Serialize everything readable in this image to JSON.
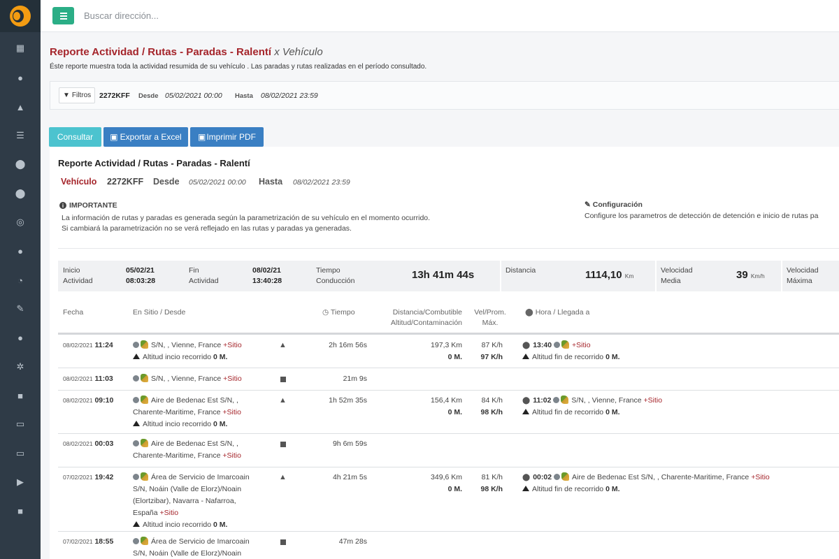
{
  "app": {
    "search_placeholder": "Buscar dirección..."
  },
  "sidebar": {
    "items": [
      {
        "icon": "dashboard-icon",
        "glyph": "▦"
      },
      {
        "icon": "globe-icon",
        "glyph": "●"
      },
      {
        "icon": "road-icon",
        "glyph": "▲"
      },
      {
        "icon": "list-icon",
        "glyph": "☰"
      },
      {
        "icon": "map-pin-icon",
        "glyph": "⬤"
      },
      {
        "icon": "map-marker-icon",
        "glyph": "⬤"
      },
      {
        "icon": "target-icon",
        "glyph": "◎"
      },
      {
        "icon": "alert-icon",
        "glyph": "●"
      },
      {
        "icon": "speedometer-icon",
        "glyph": "◔"
      },
      {
        "icon": "wrench-icon",
        "glyph": "✎"
      },
      {
        "icon": "fuel-drop-icon",
        "glyph": "●"
      },
      {
        "icon": "settings-cogs-icon",
        "glyph": "✲"
      },
      {
        "icon": "truck-icon",
        "glyph": "■"
      },
      {
        "icon": "id-card-icon",
        "glyph": "▭"
      },
      {
        "icon": "id-card-icon-2",
        "glyph": "▭"
      },
      {
        "icon": "play-icon",
        "glyph": "▶"
      },
      {
        "icon": "lock-icon",
        "glyph": "■"
      }
    ]
  },
  "page": {
    "title": "Reporte Actividad / Rutas - Paradas - Ralentí",
    "title_suffix": "x Vehículo",
    "description": "Éste reporte muestra toda la actividad resumida de su vehículo . Las paradas y rutas realizadas en el período consultado."
  },
  "filters": {
    "button_label": "Filtros",
    "plate": "2272KFF",
    "desde_label": "Desde",
    "desde_value": "05/02/2021 00:00",
    "hasta_label": "Hasta",
    "hasta_value": "08/02/2021 23:59"
  },
  "actions": {
    "consultar": "Consultar",
    "excel": "Exportar a Excel",
    "pdf": "Imprimir PDF"
  },
  "report": {
    "title": "Reporte Actividad / Rutas - Paradas - Ralentí",
    "vehicle_label": "Vehículo",
    "plate": "2272KFF",
    "desde_label": "Desde",
    "desde_value": "05/02/2021 00:00",
    "hasta_label": "Hasta",
    "hasta_value": "08/02/2021 23:59",
    "important_title": "IMPORTANTE",
    "important_line1": "La información de rutas y paradas es generada según la parametrización de su vehículo en el momento ocurrido.",
    "important_line2": "Si cambiará la parametrización no se verá reflejado en las rutas y paradas ya generadas.",
    "config_title": "Configuración",
    "config_text": "Configure los parametros de detección de detención e inicio de rutas pa"
  },
  "summary": {
    "inicio_label1": "Inicio",
    "inicio_label2": "Actividad",
    "inicio_date": "05/02/21",
    "inicio_time": "08:03:28",
    "fin_label1": "Fin",
    "fin_label2": "Actividad",
    "fin_date": "08/02/21",
    "fin_time": "13:40:28",
    "tiempo_label1": "Tiempo",
    "tiempo_label2": "Conducción",
    "tiempo_value": "13h 41m 44s",
    "distancia_label": "Distancia",
    "distancia_value": "1114,10",
    "distancia_unit": "Km",
    "velmedia_label1": "Velocidad",
    "velmedia_label2": "Media",
    "velmedia_value": "39",
    "velmedia_unit": "Km/h",
    "velmax_label1": "Velocidad",
    "velmax_label2": "Máxima"
  },
  "table": {
    "headers": {
      "fecha": "Fecha",
      "sitio": "En Sitio / Desde",
      "tiempo": "Tiempo",
      "dist1": "Distancia/Combutible",
      "dist2": "Altitud/Contaminación",
      "vel1": "Vel/Prom.",
      "vel2": "Máx.",
      "hora": "Hora / Llegada a"
    },
    "rows": [
      {
        "date": "08/02/2021",
        "time": "11:24",
        "type": "route",
        "place": "S/N, , Vienne, France",
        "sitio": "+Sitio",
        "alt_start_label": "Altitud incio recorrido",
        "alt_start_value": "0 M.",
        "duration": "2h 16m 56s",
        "distance": "197,3 Km",
        "altitude": "0 M.",
        "avg_speed": "87 K/h",
        "max_speed": "97 K/h",
        "arrival_time": "13:40",
        "arrival_place": "",
        "arrival_sitio": "+Sitio",
        "alt_end_label": "Altitud fin de recorrido",
        "alt_end_value": "0 M."
      },
      {
        "date": "08/02/2021",
        "time": "11:03",
        "type": "stop",
        "place": "S/N, , Vienne, France",
        "sitio": "+Sitio",
        "duration": "21m 9s"
      },
      {
        "date": "08/02/2021",
        "time": "09:10",
        "type": "route",
        "place_l1": "Aire de Bedenac Est S/N, ,",
        "place_l2": "Charente-Maritime, France",
        "sitio": "+Sitio",
        "alt_start_label": "Altitud incio recorrido",
        "alt_start_value": "0 M.",
        "duration": "1h 52m 35s",
        "distance": "156,4 Km",
        "altitude": "0 M.",
        "avg_speed": "84 K/h",
        "max_speed": "98 K/h",
        "arrival_time": "11:02",
        "arrival_place": "S/N, , Vienne, France",
        "arrival_sitio": "+Sitio",
        "alt_end_label": "Altitud fin de recorrido",
        "alt_end_value": "0 M."
      },
      {
        "date": "08/02/2021",
        "time": "00:03",
        "type": "stop",
        "place_l1": "Aire de Bedenac Est S/N, ,",
        "place_l2": "Charente-Maritime, France",
        "sitio": "+Sitio",
        "duration": "9h 6m 59s"
      },
      {
        "date": "07/02/2021",
        "time": "19:42",
        "type": "route",
        "place_l1": "Área de Servicio de Imarcoain",
        "place_l2": "S/N, Noáin (Valle de Elorz)/Noain",
        "place_l3": "(Elortzibar), Navarra - Nafarroa,",
        "place_l4": "España",
        "sitio": "+Sitio",
        "alt_start_label": "Altitud incio recorrido",
        "alt_start_value": "0 M.",
        "duration": "4h 21m 5s",
        "distance": "349,6 Km",
        "altitude": "0 M.",
        "avg_speed": "81 K/h",
        "max_speed": "98 K/h",
        "arrival_time": "00:02",
        "arrival_place": "Aire de Bedenac Est S/N, , Charente-Maritime, France",
        "arrival_sitio": "+Sitio",
        "alt_end_label": "Altitud fin de recorrido",
        "alt_end_value": "0 M."
      },
      {
        "date": "07/02/2021",
        "time": "18:55",
        "type": "stop",
        "place_l1": "Área de Servicio de Imarcoain",
        "place_l2": "S/N, Noáin (Valle de Elorz)/Noain",
        "duration": "47m 28s"
      }
    ]
  }
}
